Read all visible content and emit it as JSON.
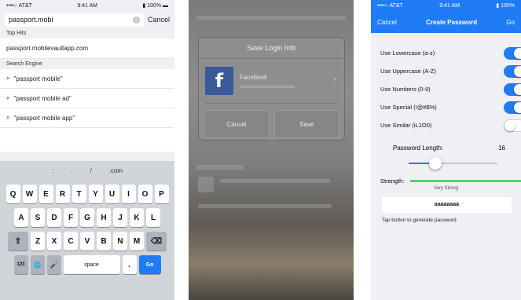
{
  "screen1": {
    "status": {
      "left": "••••○ AT&T",
      "center": "9:41 AM",
      "right": "▮ 100% ▬"
    },
    "search_value": "passport.mobi",
    "cancel_label": "Cancel",
    "top_hits_header": "Top Hits",
    "top_hit": "passport.mobilevaultapp.com",
    "suggestions_header": "Search Engine",
    "suggestions": [
      "\"passport mobile\"",
      "\"passport mobile ad\"",
      "\"passport mobile app\""
    ],
    "kb_top": [
      ":",
      ".",
      "/",
      ".com"
    ],
    "kb_row1": [
      "Q",
      "W",
      "E",
      "R",
      "T",
      "Y",
      "U",
      "I",
      "O",
      "P"
    ],
    "kb_row2": [
      "A",
      "S",
      "D",
      "F",
      "G",
      "H",
      "J",
      "K",
      "L"
    ],
    "kb_row3": [
      "Z",
      "X",
      "C",
      "V",
      "B",
      "N",
      "M"
    ],
    "kb_shift": "⇧",
    "kb_backspace": "⌫",
    "kb_123": "123",
    "kb_globe": "🌐",
    "kb_mic": "🎤",
    "kb_space": "space",
    "kb_dot": ".",
    "kb_go": "Go"
  },
  "screen2": {
    "dialog_title": "Save Login Info",
    "account_name": "Facebook",
    "fb_letter": "f",
    "cancel_label": "Cancel",
    "save_label": "Save"
  },
  "screen3": {
    "status": {
      "left": "••••○ AT&T",
      "center": "9:41 AM",
      "right": "▮ 100%"
    },
    "nav_cancel": "Cancel",
    "nav_title": "Create Password",
    "nav_right": "Go",
    "options": [
      {
        "label": "Use Lowercase (a-z)",
        "on": true
      },
      {
        "label": "Use Uppercase (A-Z)",
        "on": true
      },
      {
        "label": "Use Numbers (0-9)",
        "on": true
      },
      {
        "label": "Use Special (!@#$%)",
        "on": true
      },
      {
        "label": "Use Similar (iL1O0)",
        "on": false
      }
    ],
    "length_label": "Password Length:",
    "length_value": "16",
    "slider_fraction": 0.3,
    "strength_label": "Strength:",
    "strength_text": "Very Strong",
    "password": "aaaaaaaa",
    "hint": "Tap button to generate password."
  }
}
